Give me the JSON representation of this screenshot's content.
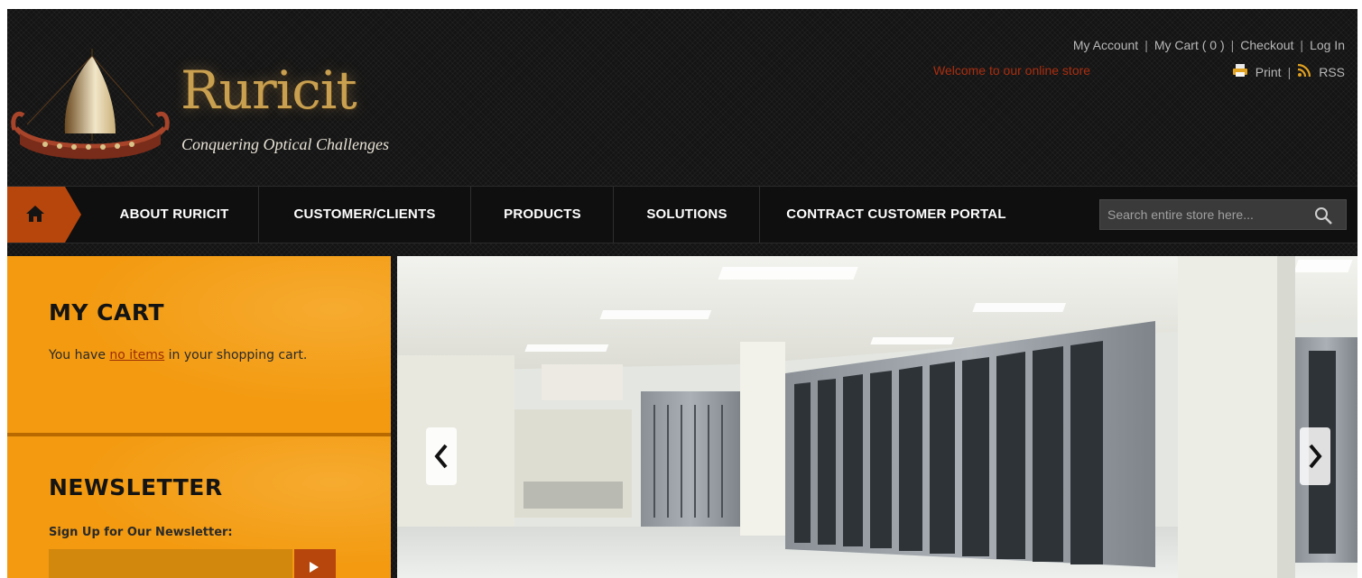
{
  "brand": {
    "name": "Ruricit",
    "tagline": "Conquering Optical Challenges"
  },
  "top_links": [
    "My Account",
    "My Cart ( 0 )",
    "Checkout",
    "Log In"
  ],
  "welcome": "Welcome to our online store",
  "utility": {
    "print": "Print",
    "rss": "RSS"
  },
  "nav": {
    "items": [
      "ABOUT RURICIT",
      "CUSTOMER/CLIENTS",
      "PRODUCTS",
      "SOLUTIONS",
      "CONTRACT CUSTOMER PORTAL"
    ],
    "search_placeholder": "Search entire store here..."
  },
  "cart": {
    "title": "MY CART",
    "text_before": "You have ",
    "link": "no items",
    "text_after": " in your shopping cart."
  },
  "newsletter": {
    "title": "NEWSLETTER",
    "label": "Sign Up for Our Newsletter:"
  },
  "colors": {
    "accent": "#b7460d",
    "panel": "#f39a10",
    "welcome": "#a92e10"
  }
}
